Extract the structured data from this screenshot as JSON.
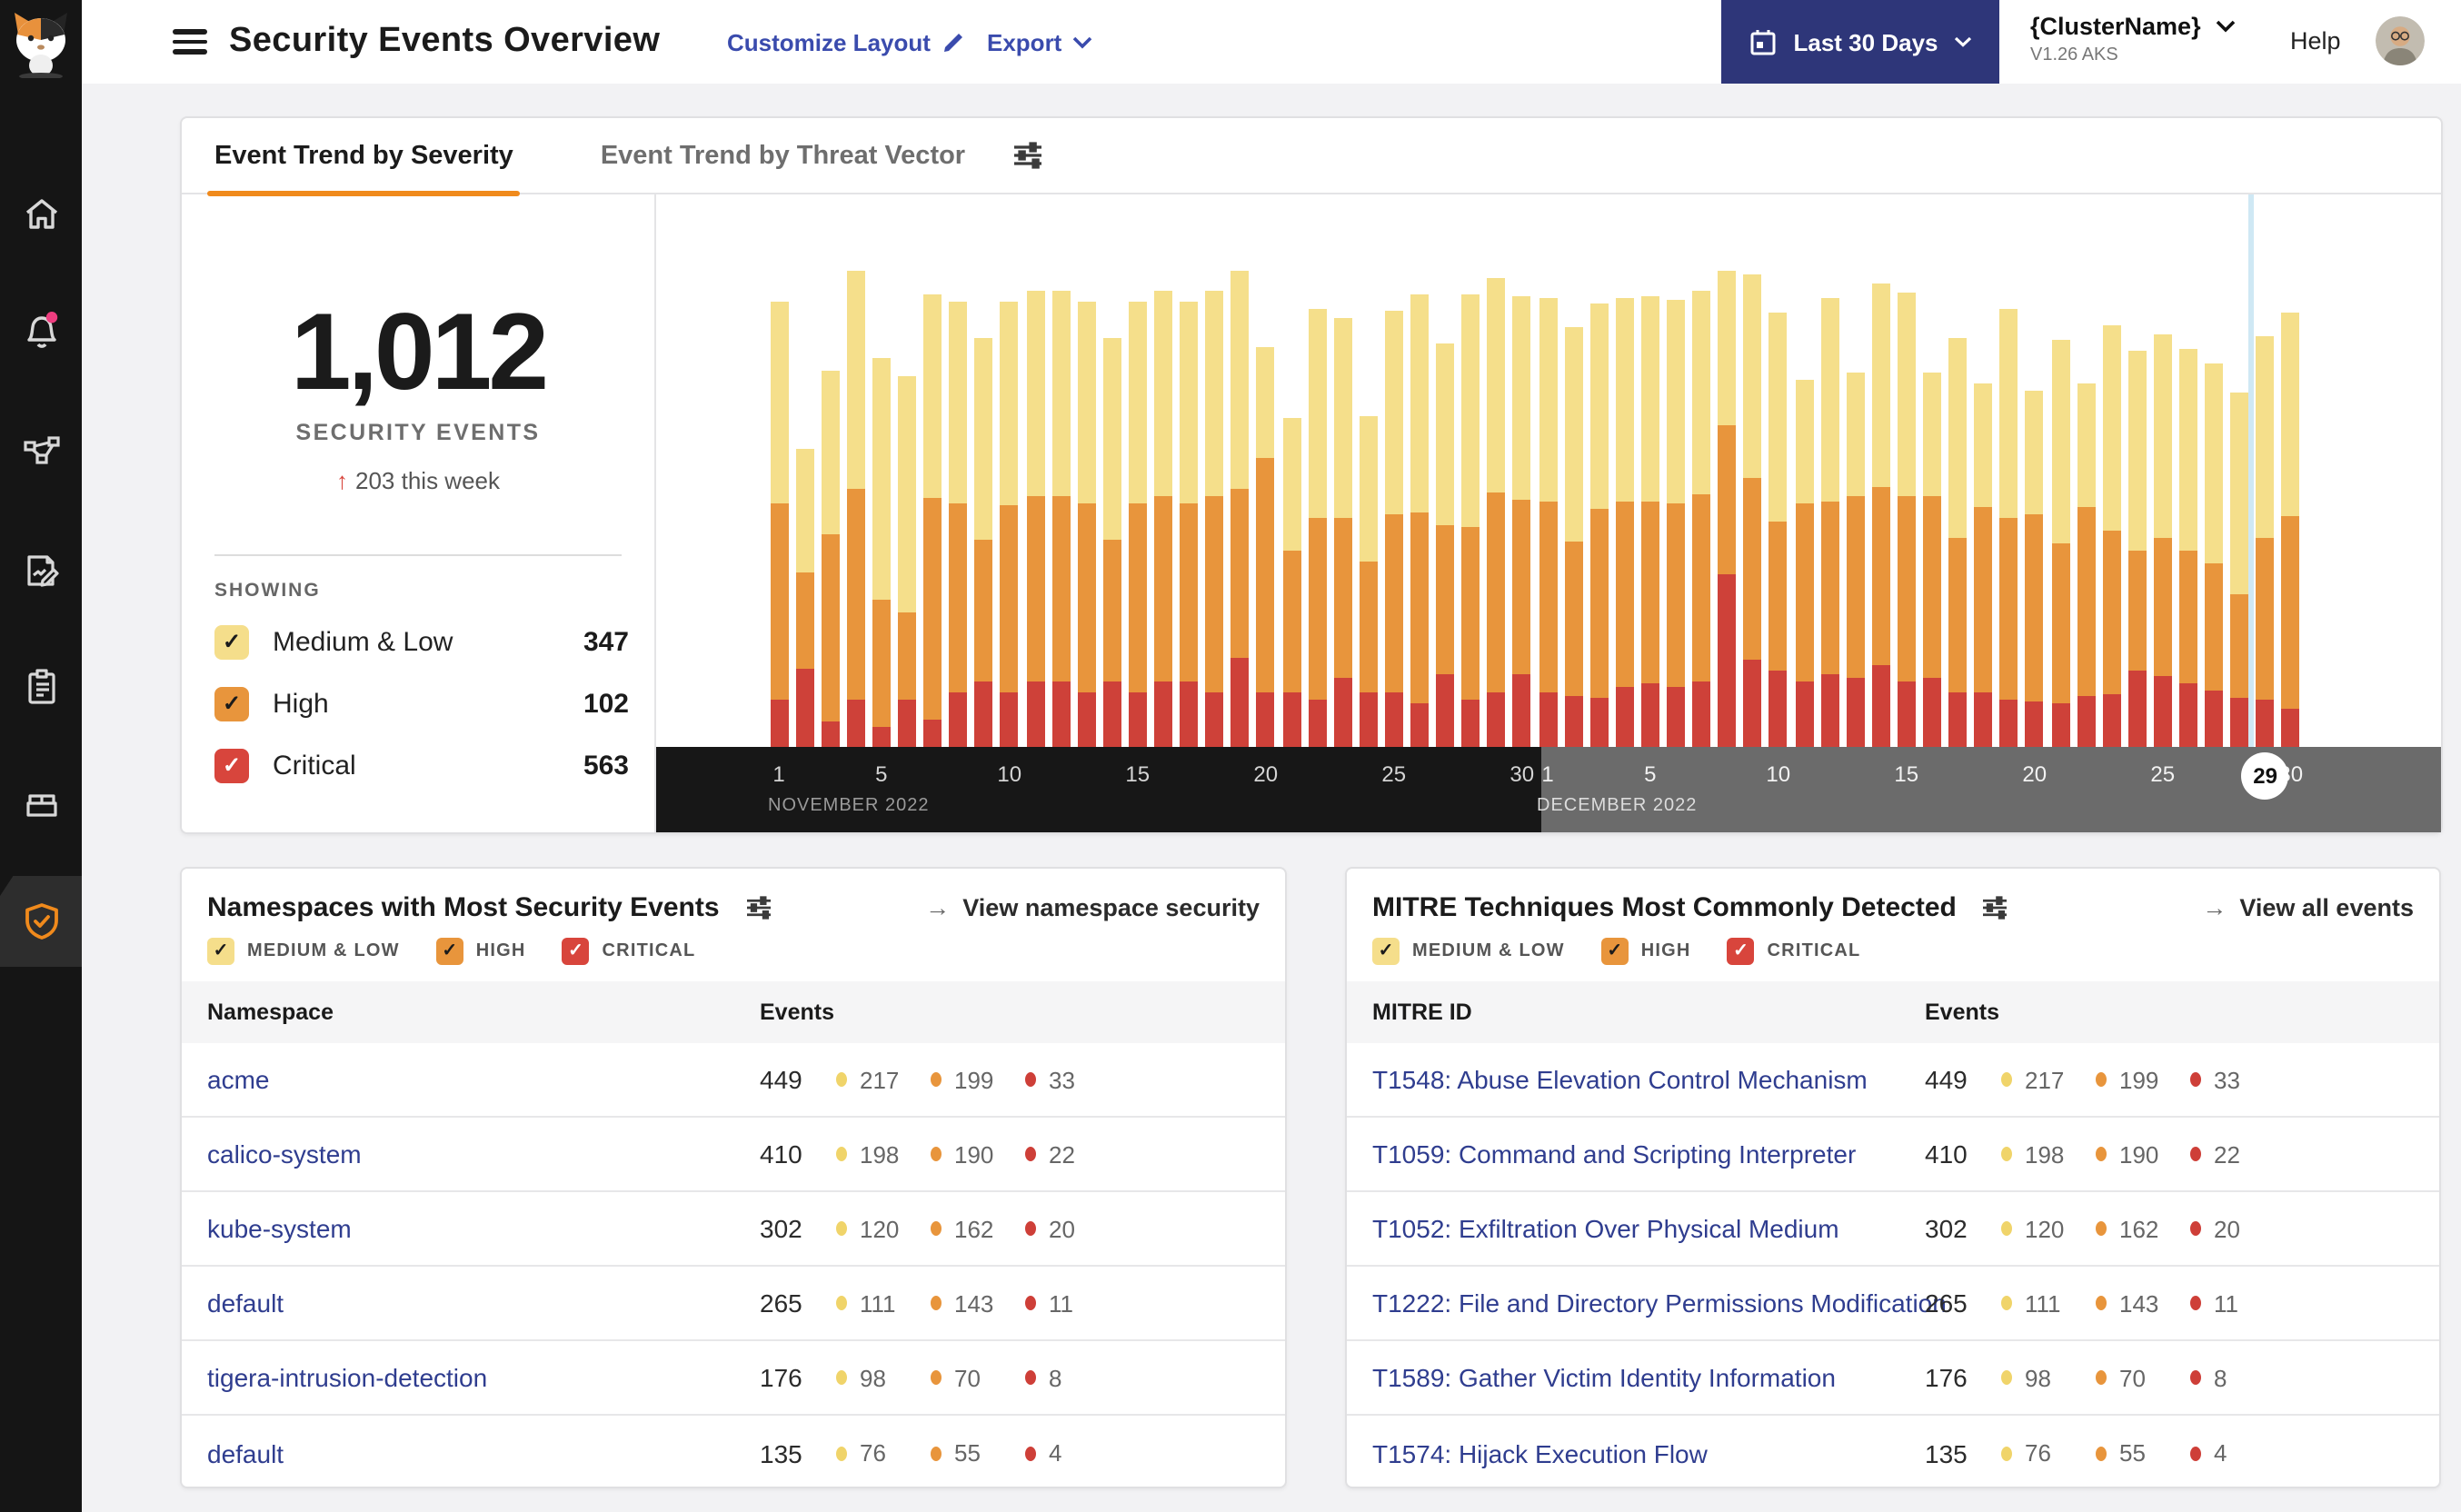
{
  "theme": {
    "accent_orange": "#f08a1c",
    "link_blue": "#3a4bad",
    "table_link_navy": "#2f3d8f",
    "severity_colors": {
      "medium_low": "#f5df8b",
      "high": "#e8953c",
      "critical": "#ce4139"
    },
    "nav_button_bg": "#2e3679"
  },
  "sidebar": {
    "icons": [
      "home",
      "alerts-bell",
      "service-graph",
      "policy-edit",
      "compliance-clipboard",
      "workloads-box",
      "threat-defense-shield"
    ],
    "active_icon": "threat-defense-shield",
    "alert_dot_color": "#ee3d7f"
  },
  "header": {
    "title": "Security Events Overview",
    "customize_layout": "Customize Layout",
    "export_label": "Export",
    "date_range": "Last 30 Days",
    "cluster_name": "{ClusterName}",
    "cluster_version": "V1.26 AKS",
    "help": "Help"
  },
  "trend_card": {
    "tabs": [
      {
        "label": "Event Trend by Severity",
        "active": true
      },
      {
        "label": "Event Trend by Threat Vector",
        "active": false
      }
    ],
    "total": "1,012",
    "total_label": "SECURITY EVENTS",
    "delta_arrow": "↑",
    "delta_text": "203 this week",
    "showing_label": "SHOWING",
    "legend": [
      {
        "key": "medium_low",
        "label": "Medium & Low",
        "value": "347"
      },
      {
        "key": "high",
        "label": "High",
        "value": "102"
      },
      {
        "key": "critical",
        "label": "Critical",
        "value": "563"
      }
    ]
  },
  "chart_data": {
    "type": "bar",
    "stacked": true,
    "series_keys": {
      "m": "medium_low",
      "h": "high",
      "c": "critical"
    },
    "legend_position": "left panel checkboxes",
    "units": "events (per-day values estimated from bar heights)",
    "grid": false,
    "current_day_marker": {
      "month_index": 1,
      "day": 29
    },
    "months": [
      {
        "label": "NOVEMBER 2022",
        "ticks": [
          1,
          5,
          10,
          15,
          20,
          25,
          30
        ],
        "days": [
          [
            111,
            108,
            26
          ],
          [
            68,
            53,
            43
          ],
          [
            90,
            103,
            14
          ],
          [
            120,
            116,
            26
          ],
          [
            133,
            70,
            11
          ],
          [
            130,
            48,
            26
          ],
          [
            112,
            122,
            15
          ],
          [
            111,
            104,
            30
          ],
          [
            111,
            78,
            36
          ],
          [
            112,
            103,
            30
          ],
          [
            113,
            102,
            36
          ],
          [
            113,
            102,
            36
          ],
          [
            111,
            104,
            30
          ],
          [
            111,
            78,
            36
          ],
          [
            111,
            104,
            30
          ],
          [
            113,
            102,
            36
          ],
          [
            111,
            98,
            36
          ],
          [
            113,
            108,
            30
          ],
          [
            120,
            93,
            49
          ],
          [
            61,
            129,
            30
          ],
          [
            73,
            78,
            30
          ],
          [
            115,
            100,
            26
          ],
          [
            110,
            88,
            38
          ],
          [
            80,
            72,
            30
          ],
          [
            112,
            98,
            30
          ],
          [
            120,
            105,
            24
          ],
          [
            100,
            82,
            40
          ],
          [
            128,
            95,
            26
          ],
          [
            118,
            110,
            30
          ],
          [
            112,
            96,
            40
          ]
        ]
      },
      {
        "label": "DECEMBER 2022",
        "ticks": [
          1,
          5,
          10,
          15,
          20,
          25,
          30
        ],
        "days": [
          [
            112,
            105,
            30
          ],
          [
            118,
            85,
            28
          ],
          [
            113,
            104,
            27
          ],
          [
            112,
            102,
            33
          ],
          [
            113,
            100,
            35
          ],
          [
            112,
            101,
            33
          ],
          [
            112,
            103,
            36
          ],
          [
            85,
            82,
            95
          ],
          [
            112,
            100,
            48
          ],
          [
            115,
            82,
            42
          ],
          [
            68,
            98,
            36
          ],
          [
            112,
            95,
            40
          ],
          [
            68,
            100,
            38
          ],
          [
            112,
            98,
            45
          ],
          [
            112,
            102,
            36
          ],
          [
            68,
            100,
            38
          ],
          [
            110,
            85,
            30
          ],
          [
            68,
            102,
            30
          ],
          [
            115,
            100,
            26
          ],
          [
            68,
            103,
            25
          ],
          [
            112,
            88,
            24
          ],
          [
            68,
            104,
            28
          ],
          [
            113,
            90,
            29
          ],
          [
            110,
            66,
            42
          ],
          [
            112,
            76,
            39
          ],
          [
            111,
            73,
            35
          ],
          [
            110,
            70,
            31
          ],
          [
            111,
            57,
            27
          ],
          [
            111,
            89,
            26
          ],
          [
            112,
            106,
            21
          ]
        ]
      }
    ]
  },
  "namespaces_card": {
    "title": "Namespaces with Most Security Events",
    "action": "View namespace security",
    "action_arrow": "→",
    "filters": [
      "MEDIUM & LOW",
      "HIGH",
      "CRITICAL"
    ],
    "columns": [
      "Namespace",
      "Events"
    ],
    "rows": [
      {
        "name": "acme",
        "total": "449",
        "medium_low": "217",
        "high": "199",
        "critical": "33"
      },
      {
        "name": "calico-system",
        "total": "410",
        "medium_low": "198",
        "high": "190",
        "critical": "22"
      },
      {
        "name": "kube-system",
        "total": "302",
        "medium_low": "120",
        "high": "162",
        "critical": "20"
      },
      {
        "name": "default",
        "total": "265",
        "medium_low": "111",
        "high": "143",
        "critical": "11"
      },
      {
        "name": "tigera-intrusion-detection",
        "total": "176",
        "medium_low": "98",
        "high": "70",
        "critical": "8"
      },
      {
        "name": "default",
        "total": "135",
        "medium_low": "76",
        "high": "55",
        "critical": "4"
      }
    ]
  },
  "mitre_card": {
    "title": "MITRE Techniques Most Commonly Detected",
    "action": "View all events",
    "action_arrow": "→",
    "filters": [
      "MEDIUM & LOW",
      "HIGH",
      "CRITICAL"
    ],
    "columns": [
      "MITRE ID",
      "Events"
    ],
    "rows": [
      {
        "name": "T1548: Abuse Elevation Control Mechanism",
        "total": "449",
        "medium_low": "217",
        "high": "199",
        "critical": "33"
      },
      {
        "name": "T1059: Command and Scripting Interpreter",
        "total": "410",
        "medium_low": "198",
        "high": "190",
        "critical": "22"
      },
      {
        "name": "T1052: Exfiltration Over Physical Medium",
        "total": "302",
        "medium_low": "120",
        "high": "162",
        "critical": "20"
      },
      {
        "name": "T1222: File and Directory Permissions Modification",
        "total": "265",
        "medium_low": "111",
        "high": "143",
        "critical": "11"
      },
      {
        "name": "T1589: Gather Victim Identity Information",
        "total": "176",
        "medium_low": "98",
        "high": "70",
        "critical": "8"
      },
      {
        "name": "T1574: Hijack Execution Flow",
        "total": "135",
        "medium_low": "76",
        "high": "55",
        "critical": "4"
      }
    ]
  }
}
